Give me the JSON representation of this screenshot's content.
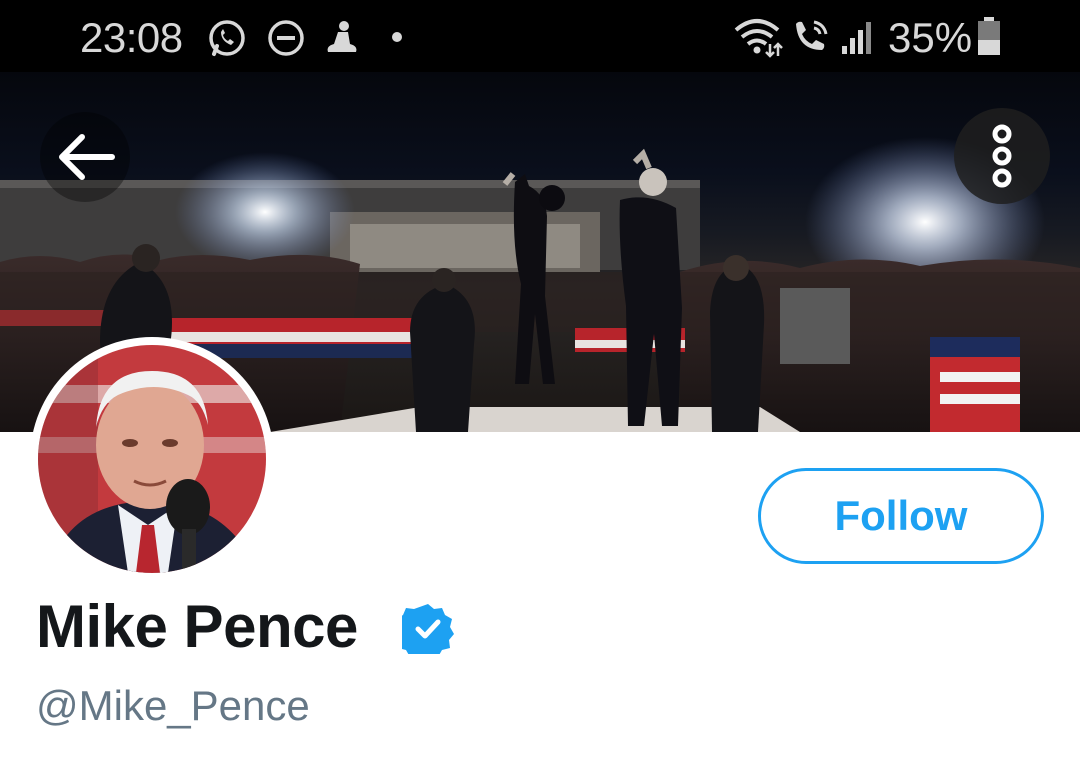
{
  "status_bar": {
    "time": "23:08",
    "battery": "35%",
    "left_icons": [
      "whatsapp-icon",
      "do-not-disturb-icon",
      "notification-app-icon",
      "dot-icon"
    ],
    "right_icons": [
      "wifi-icon",
      "wifi-calling-icon",
      "signal-icon",
      "battery-icon"
    ]
  },
  "header": {
    "back_icon": "arrow-left-icon",
    "more_icon": "more-vertical-icon"
  },
  "profile": {
    "name": "Mike Pence",
    "handle": "@Mike_Pence",
    "verified": true,
    "follow_label": "Follow"
  },
  "colors": {
    "accent": "#1da1f2",
    "name_text": "#14171a",
    "handle_text": "#657786",
    "status_bar_bg": "#000000"
  }
}
